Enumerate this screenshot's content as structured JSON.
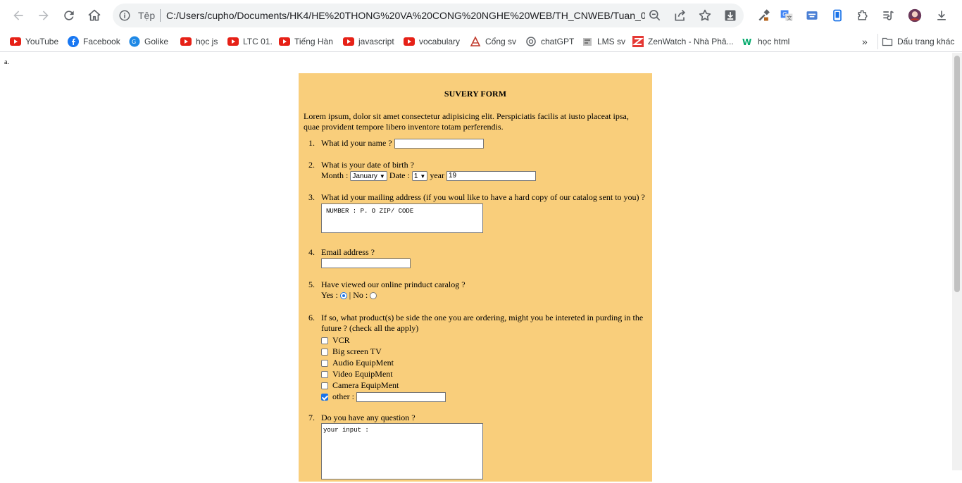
{
  "browser": {
    "scheme_label": "Tệp",
    "url": "C:/Users/cupho/Documents/HK4/HE%20THONG%20VA%20CONG%20NGHE%20WEB/TH_CNWEB/Tuan_02/..."
  },
  "bookmarks": [
    {
      "label": "YouTube",
      "icon": "youtube-icon"
    },
    {
      "label": "Facebook",
      "icon": "facebook-icon"
    },
    {
      "label": "Golike",
      "icon": "golike-icon"
    },
    {
      "label": "học js",
      "icon": "youtube-icon"
    },
    {
      "label": "LTC 01.",
      "icon": "youtube-icon"
    },
    {
      "label": "Tiếng Hàn",
      "icon": "youtube-icon"
    },
    {
      "label": "javascript",
      "icon": "youtube-icon"
    },
    {
      "label": "vocabulary",
      "icon": "youtube-icon"
    },
    {
      "label": "Cổng sv",
      "icon": "university-icon"
    },
    {
      "label": "chatGPT",
      "icon": "chatgpt-icon"
    },
    {
      "label": "LMS sv",
      "icon": "lms-icon"
    },
    {
      "label": "ZenWatch - Nhà Phâ...",
      "icon": "zenwatch-icon"
    },
    {
      "label": "học html",
      "icon": "w3schools-icon"
    }
  ],
  "bookmarks_other": "Dấu trang khác",
  "page": {
    "mark": "a.",
    "title": "SUVERY FORM",
    "intro": "Lorem ipsum, dolor sit amet consectetur adipisicing elit. Perspiciatis facilis at iusto placeat ipsa, quae provident tempore libero inventore totam perferendis.",
    "questions": {
      "q1": {
        "num": "1.",
        "label": "What id your name ?",
        "value": ""
      },
      "q2": {
        "num": "2.",
        "label": "What is your date of birth ?",
        "month_label": "Month :",
        "month_value": "January",
        "date_label": "Date :",
        "date_value": "1",
        "year_label": "year",
        "year_value": "19"
      },
      "q3": {
        "num": "3.",
        "label": "What id your mailing address (if you woul like to have a hard copy of our catalog sent to you) ?",
        "value": "NUMBER : P. O ZIP/ CODE"
      },
      "q4": {
        "num": "4.",
        "label": "Email address ?",
        "value": ""
      },
      "q5": {
        "num": "5.",
        "label": "Have viewed our online prinduct caralog ?",
        "yes_label": "Yes :",
        "no_label": "| No :",
        "selected": "yes"
      },
      "q6": {
        "num": "6.",
        "label": "If so, what product(s) be side the one you are ordering, might you be intereted in purding in the future ? (check all the apply)",
        "options": [
          {
            "label": "VCR",
            "checked": false
          },
          {
            "label": "Big screen TV",
            "checked": false
          },
          {
            "label": "Audio EquipMent",
            "checked": false
          },
          {
            "label": "Video EquipMent",
            "checked": false
          },
          {
            "label": "Camera EquipMent",
            "checked": false
          },
          {
            "label": "other :",
            "checked": true
          }
        ],
        "other_value": ""
      },
      "q7": {
        "num": "7.",
        "label": "Do you have any question ?",
        "value": "your input :"
      }
    }
  },
  "colors": {
    "form_background": "#f9ce7b",
    "accent": "#1a73e8"
  }
}
